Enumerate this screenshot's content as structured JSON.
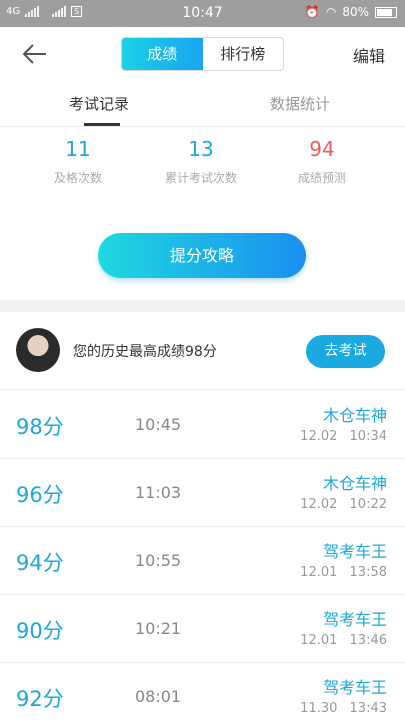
{
  "status_bar": {
    "network": "4G",
    "sim_badge": "S",
    "time": "10:47",
    "battery": "80%"
  },
  "header": {
    "tabs": [
      {
        "label": "成绩",
        "active": true
      },
      {
        "label": "排行榜",
        "active": false
      }
    ],
    "edit_label": "编辑"
  },
  "sub_tabs": [
    {
      "label": "考试记录",
      "active": true
    },
    {
      "label": "数据统计",
      "active": false
    }
  ],
  "stats": [
    {
      "value": "11",
      "label": "及格次数"
    },
    {
      "value": "13",
      "label": "累计考试次数"
    },
    {
      "value": "94",
      "label": "成绩预测"
    }
  ],
  "cta_label": "提分攻略",
  "best": {
    "text": "您的历史最高成绩98分",
    "button_label": "去考试"
  },
  "records": [
    {
      "score": "98分",
      "duration": "10:45",
      "title": "木仓车神",
      "date": "12.02",
      "time": "10:34"
    },
    {
      "score": "96分",
      "duration": "11:03",
      "title": "木仓车神",
      "date": "12.02",
      "time": "10:22"
    },
    {
      "score": "94分",
      "duration": "10:55",
      "title": "驾考车王",
      "date": "12.01",
      "time": "13:58"
    },
    {
      "score": "90分",
      "duration": "10:21",
      "title": "驾考车王",
      "date": "12.01",
      "time": "13:46"
    },
    {
      "score": "92分",
      "duration": "08:01",
      "title": "驾考车王",
      "date": "11.30",
      "time": "13:43"
    }
  ],
  "colors": {
    "accent": "#1ea7d8",
    "prediction": "#ef5a5a"
  }
}
